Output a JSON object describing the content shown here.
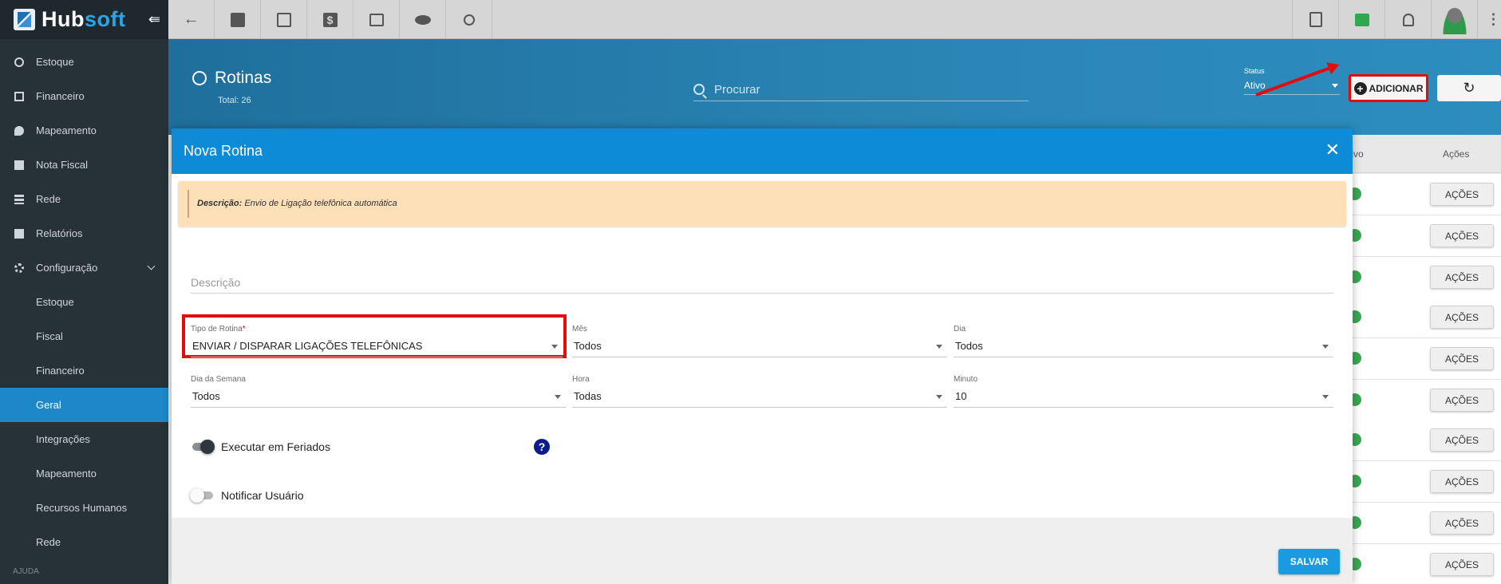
{
  "brand": {
    "name_a": "Hub",
    "name_b": "soft"
  },
  "sidebar": {
    "items": [
      {
        "label": "Estoque"
      },
      {
        "label": "Financeiro"
      },
      {
        "label": "Mapeamento"
      },
      {
        "label": "Nota Fiscal"
      },
      {
        "label": "Rede"
      },
      {
        "label": "Relatórios"
      },
      {
        "label": "Configuração"
      }
    ],
    "submenu": [
      {
        "label": "Estoque"
      },
      {
        "label": "Fiscal"
      },
      {
        "label": "Financeiro"
      },
      {
        "label": "Geral"
      },
      {
        "label": "Integrações"
      },
      {
        "label": "Mapeamento"
      },
      {
        "label": "Recursos Humanos"
      },
      {
        "label": "Rede"
      }
    ],
    "section": "AJUDA"
  },
  "page": {
    "title": "Rotinas",
    "total": "Total: 26",
    "search_placeholder": "Procurar",
    "status_label": "Status",
    "status_value": "Ativo",
    "add_label": "ADICIONAR"
  },
  "table": {
    "col_ativo": "tivo",
    "col_acoes": "Ações",
    "row_button": "AÇÕES"
  },
  "modal": {
    "title": "Nova Rotina",
    "alert_label": "Descrição:",
    "alert_text": " Envio de Ligação telefônica automática",
    "descricao_placeholder": "Descrição",
    "tipo_label": "Tipo de Rotina",
    "tipo_req": "*",
    "tipo_value": "ENVIAR / DISPARAR LIGAÇÕES TELEFÔNICAS",
    "mes_label": "Mês",
    "mes_value": "Todos",
    "dia_label": "Dia",
    "dia_value": "Todos",
    "dia_semana_label": "Dia da Semana",
    "dia_semana_value": "Todos",
    "hora_label": "Hora",
    "hora_value": "Todas",
    "minuto_label": "Minuto",
    "minuto_value": "10",
    "feriados_label": "Executar em Feriados",
    "feriados_on": true,
    "notificar_label": "Notificar Usuário",
    "notificar_on": false,
    "help": "?",
    "save_label": "SALVAR"
  },
  "colors": {
    "accent": "#0e8bd6",
    "highlight": "#e30b0b",
    "sidebar_active": "#1c87c9"
  }
}
